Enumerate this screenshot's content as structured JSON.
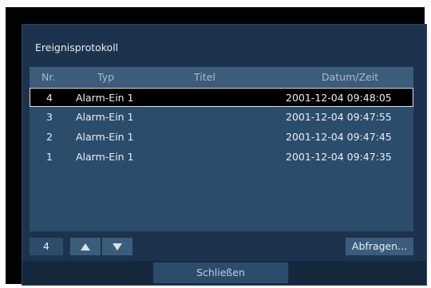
{
  "dialog": {
    "title": "Ereignisprotokoll",
    "columns": {
      "nr": "Nr.",
      "typ": "Typ",
      "titel": "Titel",
      "datum": "Datum/Zeit"
    },
    "rows": [
      {
        "nr": "4",
        "typ": "Alarm-Ein 1",
        "titel": "",
        "datum": "2001-12-04 09:48:05",
        "selected": true
      },
      {
        "nr": "3",
        "typ": "Alarm-Ein 1",
        "titel": "",
        "datum": "2001-12-04 09:47:55",
        "selected": false
      },
      {
        "nr": "2",
        "typ": "Alarm-Ein 1",
        "titel": "",
        "datum": "2001-12-04 09:47:45",
        "selected": false
      },
      {
        "nr": "1",
        "typ": "Alarm-Ein 1",
        "titel": "",
        "datum": "2001-12-04 09:47:35",
        "selected": false
      }
    ],
    "count_field": "4",
    "up_icon": "triangle-up-icon",
    "down_icon": "triangle-down-icon",
    "query_button": "Abfragen...",
    "close_button": "Schließen"
  },
  "colors": {
    "dialog_bg": "#1d334d",
    "list_bg": "#2c4c6c",
    "header_bg": "#3c5c7c",
    "selection_bg": "#000000"
  }
}
